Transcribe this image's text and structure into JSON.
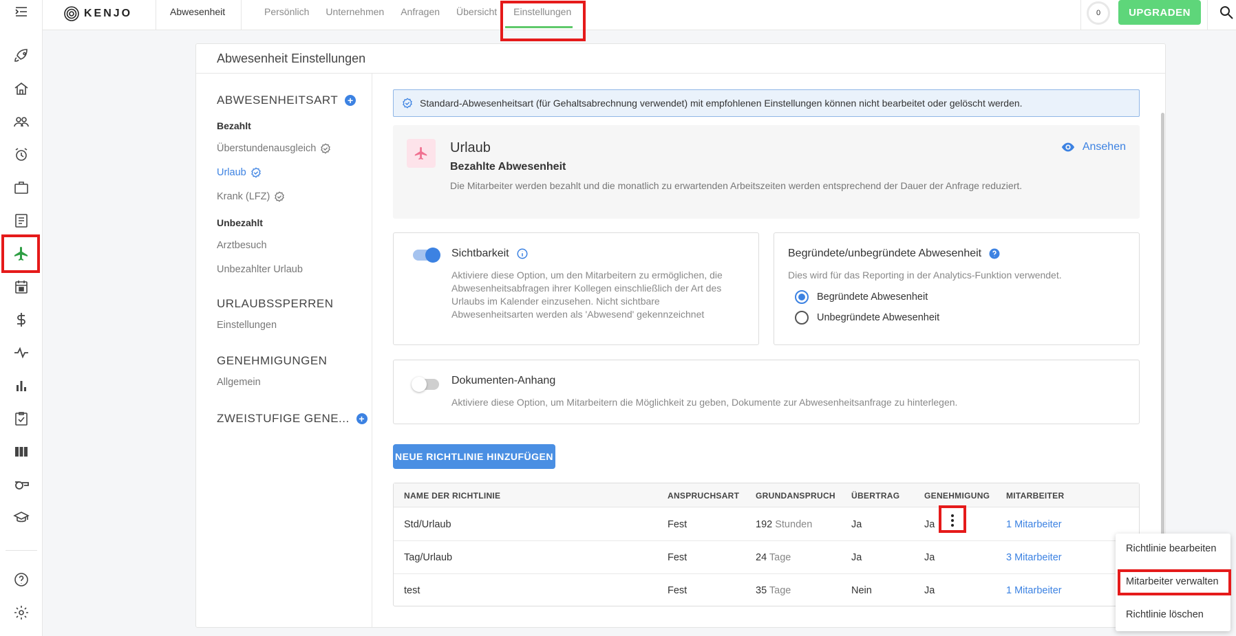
{
  "brand": {
    "name": "KENJO"
  },
  "topbar": {
    "section_title": "Abwesenheit",
    "tabs": [
      "Persönlich",
      "Unternehmen",
      "Anfragen",
      "Übersicht",
      "Einstellungen"
    ],
    "active_tab": "Einstellungen",
    "counter": "0",
    "upgrade_label": "UPGRADEN"
  },
  "rail": {
    "items": [
      "menu-toggle-icon",
      "rocket-icon",
      "home-icon",
      "people-icon",
      "alarm-icon",
      "briefcase-icon",
      "document-icon",
      "airplane-icon",
      "calendar-icon",
      "dollar-icon",
      "pulse-icon",
      "bar-chart-icon",
      "checklist-icon",
      "columns-icon",
      "whistle-icon",
      "graduation-cap-icon",
      "help-icon",
      "settings-icon"
    ],
    "active": "airplane-icon",
    "accent": "#2f9e44"
  },
  "card": {
    "title": "Abwesenheit Einstellungen"
  },
  "left_nav": {
    "section1": "ABWESENHEITSART",
    "paid_header": "Bezahlt",
    "paid_items": [
      "Überstundenausgleich",
      "Urlaub",
      "Krank (LFZ)"
    ],
    "active_item": "Urlaub",
    "unpaid_header": "Unbezahlt",
    "unpaid_items": [
      "Arztbesuch",
      "Unbezahlter Urlaub"
    ],
    "section2": "URLAUBSSPERREN",
    "section2_item": "Einstellungen",
    "section3": "GENEHMIGUNGEN",
    "section3_item": "Allgemein",
    "section4": "ZWEISTUFIGE GENE..."
  },
  "info_banner": "Standard-Abwesenheitsart (für Gehaltsabrechnung verwendet) mit empfohlenen Einstellungen können nicht bearbeitet oder gelöscht werden.",
  "summary": {
    "title": "Urlaub",
    "subtitle": "Bezahlte Abwesenheit",
    "description": "Die Mitarbeiter werden bezahlt und die monatlich zu erwartenden Arbeitszeiten werden entsprechend der Dauer der Anfrage reduziert.",
    "view_label": "Ansehen"
  },
  "visibility": {
    "title": "Sichtbarkeit",
    "enabled": true,
    "description": "Aktiviere diese Option, um den Mitarbeitern zu ermöglichen, die Abwesenheitsabfragen ihrer Kollegen einschließlich der Art des Urlaubs im Kalender einzusehen. Nicht sichtbare Abwesenheitsarten werden als 'Abwesend' gekennzeichnet"
  },
  "justified": {
    "title": "Begründete/unbegründete Abwesenheit",
    "description": "Dies wird für das Reporting in der Analytics-Funktion verwendet.",
    "options": [
      "Begründete Abwesenheit",
      "Unbegründete Abwesenheit"
    ],
    "selected": "Begründete Abwesenheit"
  },
  "attachment": {
    "title": "Dokumenten-Anhang",
    "enabled": false,
    "description": "Aktiviere diese Option, um Mitarbeitern die Möglichkeit zu geben, Dokumente zur Abwesenheitsanfrage zu hinterlegen."
  },
  "add_policy_label": "NEUE RICHTLINIE HINZUFÜGEN",
  "table": {
    "headers": [
      "NAME DER RICHTLINIE",
      "ANSPRUCHSART",
      "GRUNDANSPRUCH",
      "ÜBERTRAG",
      "GENEHMIGUNG",
      "MITARBEITER"
    ],
    "rows": [
      {
        "name": "Std/Urlaub",
        "type": "Fest",
        "amount": "192",
        "unit": "Stunden",
        "carryover": "Ja",
        "approval": "Ja",
        "employees": "1 Mitarbeiter"
      },
      {
        "name": "Tag/Urlaub",
        "type": "Fest",
        "amount": "24",
        "unit": "Tage",
        "carryover": "Ja",
        "approval": "Ja",
        "employees": "3 Mitarbeiter"
      },
      {
        "name": "test",
        "type": "Fest",
        "amount": "35",
        "unit": "Tage",
        "carryover": "Nein",
        "approval": "Ja",
        "employees": "1 Mitarbeiter"
      }
    ]
  },
  "row_menu": {
    "items": [
      "Richtlinie bearbeiten",
      "Mitarbeiter verwalten",
      "Richtlinie löschen"
    ],
    "highlighted": "Mitarbeiter verwalten"
  },
  "colors": {
    "accent_blue": "#3c82e2",
    "upgrade_green": "#5ed67a",
    "highlight_red": "#e51a1a",
    "vacation_pink": "#f07090"
  }
}
